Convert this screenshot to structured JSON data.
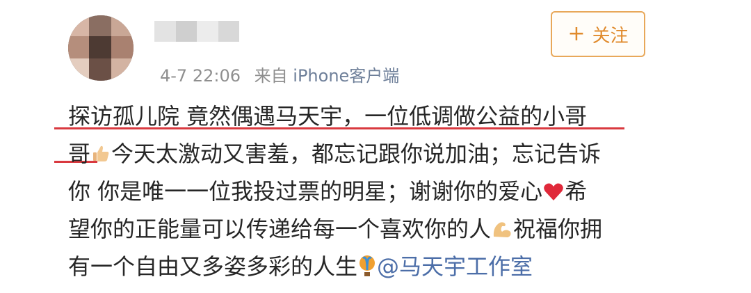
{
  "post": {
    "time": "4-7 22:06",
    "source_prefix": "来自",
    "source_name": "iPhone客户端",
    "follow_label": "关注",
    "follow_plus": "+",
    "lines": [
      "探访孤儿院 竟然偶遇马天宇，一位低调做公益的小哥",
      "今天太激动又害羞，都忘记跟你说加油；忘记告诉",
      "你 你是唯一一位我投过票的明星；谢谢你的爱心",
      "希",
      "望你的正能量可以传递给每一个喜欢你的人",
      "祝福你拥",
      "有一个自由又多姿多彩的人生",
      "@马天宇工作室"
    ],
    "line2_prefix": "哥"
  },
  "colors": {
    "follow_accent": "#e08a2c",
    "underline": "#d9393f",
    "mention": "#4c6ea8",
    "meta_gray": "#8f8f8f"
  },
  "icons": [
    "thumbs-up-emoji",
    "red-heart-emoji",
    "flexed-biceps-emoji",
    "hot-air-balloon-emoji"
  ]
}
